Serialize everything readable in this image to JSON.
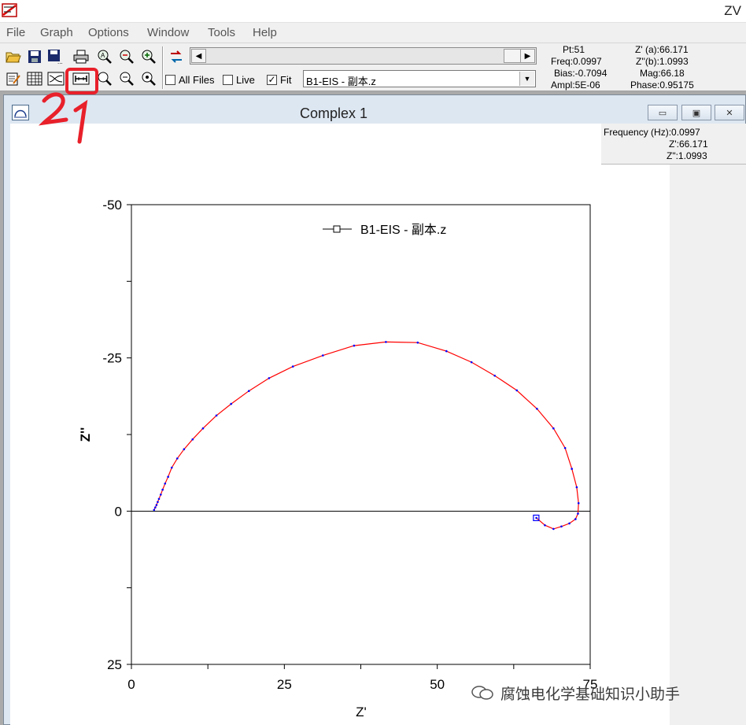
{
  "app": {
    "title": "ZV"
  },
  "menu": {
    "items": [
      "File",
      "Graph",
      "Options",
      "Window",
      "Tools",
      "Help"
    ]
  },
  "toolbar": {
    "checkboxes": [
      {
        "label": "All Files",
        "checked": false
      },
      {
        "label": "Live",
        "checked": false
      },
      {
        "label": "Fit",
        "checked": true
      }
    ],
    "file_select": {
      "value": "B1-EIS - 副本.z"
    }
  },
  "readouts": {
    "pt": "Pt:51",
    "freq": "Freq:0.0997",
    "bias": "Bias:-0.7094",
    "ampl": "Ampl:5E-06",
    "z_real": "Z' (a):66.171",
    "z_imag": "Z''(b):1.0993",
    "mag": "Mag:66.18",
    "phase": "Phase:0.95175"
  },
  "window": {
    "title": "Complex 1",
    "buttons": {
      "minimize": "▭",
      "restore": "▣",
      "close": "✕"
    }
  },
  "info_box": {
    "frequency": "Frequency (Hz):0.0997",
    "z_real": "Z':66.171",
    "z_imag": "Z\":1.0993"
  },
  "annotation": {
    "text": "21",
    "color": "#e8202a"
  },
  "watermark": {
    "text": "腐蚀电化学基础知识小助手"
  },
  "colors": {
    "fit_line": "#ff0000",
    "data_points": "#0000ff",
    "axis": "#000000"
  },
  "chart_data": {
    "type": "line",
    "xlabel": "Z'",
    "ylabel": "Z''",
    "xlim": [
      0,
      75
    ],
    "ylim": [
      -50,
      25
    ],
    "y_inverted": true,
    "x_ticks": [
      0,
      25,
      50,
      75
    ],
    "y_ticks": [
      -50,
      -25,
      0,
      25
    ],
    "x_tick_labels": [
      "0",
      "25",
      "50",
      "75"
    ],
    "y_tick_labels": [
      "-50",
      "-25",
      "0",
      "25"
    ],
    "legend": {
      "entry": "B1-EIS - 副本.z",
      "placement": "top"
    },
    "series": [
      {
        "name": "B1-EIS - 副本.z",
        "x": [
          3.7,
          3.9,
          4.1,
          4.3,
          4.5,
          4.8,
          5.1,
          5.5,
          6.0,
          6.6,
          7.5,
          8.6,
          10.0,
          11.7,
          13.9,
          16.3,
          19.2,
          22.5,
          26.4,
          31.3,
          36.4,
          41.6,
          46.8,
          51.5,
          55.6,
          59.4,
          63.0,
          66.3,
          69.0,
          70.9,
          72.0,
          72.8,
          73.1,
          73.0,
          72.6,
          71.6,
          70.3,
          69.0,
          67.6,
          66.2
        ],
        "y": [
          -0.2,
          -0.6,
          -1.0,
          -1.5,
          -2.0,
          -2.7,
          -3.5,
          -4.5,
          -5.6,
          -7.1,
          -8.6,
          -10.1,
          -11.7,
          -13.5,
          -15.6,
          -17.5,
          -19.6,
          -21.7,
          -23.6,
          -25.4,
          -27.0,
          -27.6,
          -27.5,
          -26.1,
          -24.3,
          -22.1,
          -19.7,
          -16.7,
          -13.5,
          -10.3,
          -6.9,
          -3.9,
          -1.3,
          0.4,
          1.3,
          2.0,
          2.5,
          2.9,
          2.3,
          1.1
        ]
      }
    ],
    "highlighted_point": {
      "x": 66.171,
      "y": 1.0993
    }
  }
}
